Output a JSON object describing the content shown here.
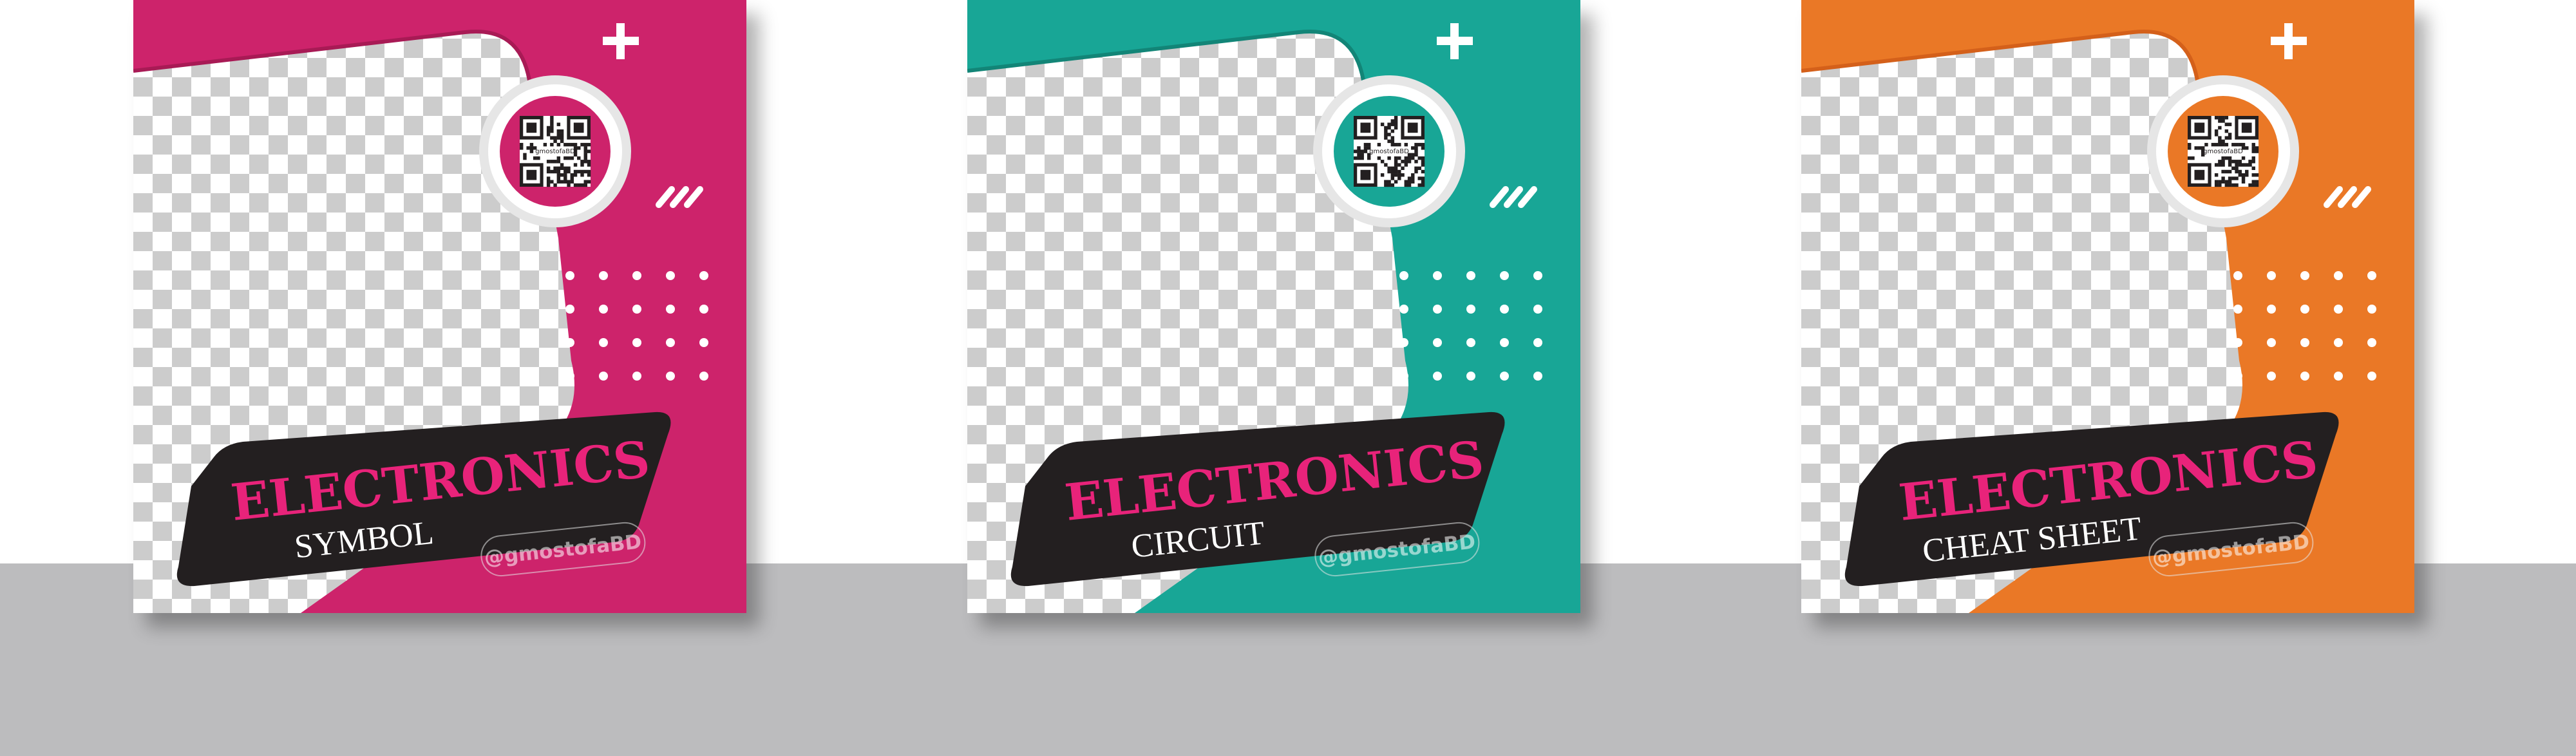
{
  "background_colors": {
    "page": "#ffffff",
    "floor": "#bcbcbe",
    "checker_light": "#ffffff",
    "checker_dark": "#cccccc",
    "label_panel": "#231f20"
  },
  "cards": [
    {
      "accent": "#cd236b",
      "accent_dark": "#a81a55",
      "qr_ring": "#cd236b",
      "title_color": "#e8237a",
      "title": "ELECTRONICS",
      "subtitle": "SYMBOL",
      "handle": "@gmostofaBD",
      "qr_caption": "gmostofaBD",
      "icons": [
        "plus-icon",
        "qr-code-icon",
        "slash-stripes-icon",
        "dot-grid-icon"
      ]
    },
    {
      "accent": "#18a696",
      "accent_dark": "#128577",
      "qr_ring": "#18a696",
      "title_color": "#e8237a",
      "title": "ELECTRONICS",
      "subtitle": "CIRCUIT",
      "handle": "@gmostofaBD",
      "qr_caption": "gmostofaBD",
      "icons": [
        "plus-icon",
        "qr-code-icon",
        "slash-stripes-icon",
        "dot-grid-icon"
      ]
    },
    {
      "accent": "#ea7826",
      "accent_dark": "#d4601a",
      "qr_ring": "#ea7826",
      "title_color": "#e8237a",
      "title": "ELECTRONICS",
      "subtitle": "CHEAT SHEET",
      "handle": "@gmostofaBD",
      "qr_caption": "gmostofaBD",
      "icons": [
        "plus-icon",
        "qr-code-icon",
        "slash-stripes-icon",
        "dot-grid-icon"
      ]
    }
  ]
}
